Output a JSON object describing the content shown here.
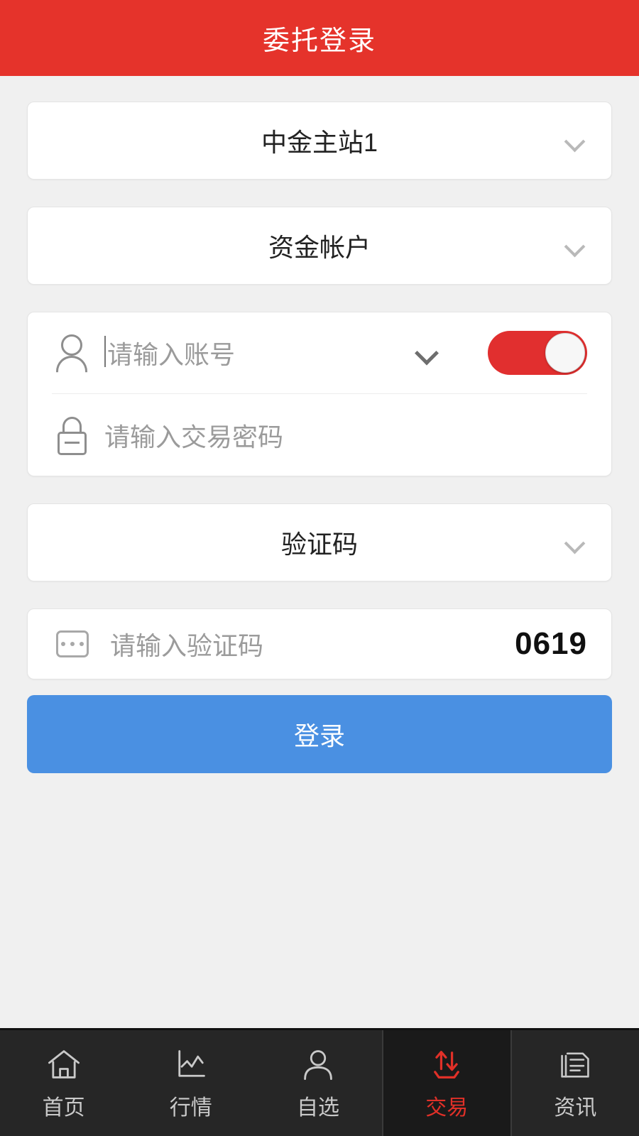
{
  "header": {
    "title": "委托登录",
    "background_color": "#e5332b",
    "text_color": "#ffffff"
  },
  "form": {
    "station_select": {
      "value": "中金主站1",
      "chevron_icon": "chevron-down-icon"
    },
    "account_type_select": {
      "value": "资金帐户",
      "chevron_icon": "chevron-down-icon"
    },
    "account_field": {
      "placeholder": "请输入账号",
      "icon": "person-icon",
      "chevron_icon": "chevron-down-icon",
      "toggle_on": true,
      "toggle_color": "#e12f2f"
    },
    "password_field": {
      "placeholder": "请输入交易密码",
      "icon": "lock-icon"
    },
    "captcha_select": {
      "value": "验证码",
      "chevron_icon": "chevron-down-icon"
    },
    "captcha_field": {
      "placeholder": "请输入验证码",
      "icon": "code-box-icon",
      "code": "0619"
    },
    "login_button": {
      "label": "登录",
      "color": "#4a90e2"
    }
  },
  "navbar": {
    "active_color": "#e03028",
    "inactive_color": "#c9c9c9",
    "items": [
      {
        "label": "首页",
        "icon": "home-icon",
        "active": false
      },
      {
        "label": "行情",
        "icon": "chart-icon",
        "active": false
      },
      {
        "label": "自选",
        "icon": "person-icon",
        "active": false
      },
      {
        "label": "交易",
        "icon": "transfer-icon",
        "active": true
      },
      {
        "label": "资讯",
        "icon": "news-icon",
        "active": false
      }
    ]
  }
}
